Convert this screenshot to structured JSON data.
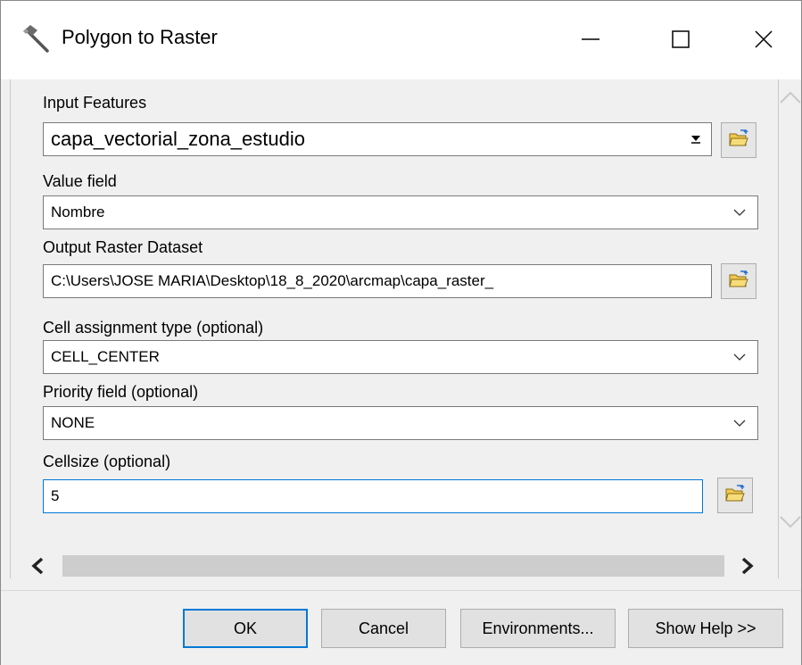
{
  "window": {
    "title": "Polygon to Raster",
    "icon": "hammer-icon",
    "controls": [
      "minimize-icon",
      "maximize-icon",
      "close-icon"
    ]
  },
  "fields": {
    "input_features": {
      "label": "Input Features",
      "value": "capa_vectorial_zona_estudio"
    },
    "value_field": {
      "label": "Value field",
      "value": "Nombre"
    },
    "output_raster": {
      "label": "Output Raster Dataset",
      "value": "C:\\Users\\JOSE MARIA\\Desktop\\18_8_2020\\arcmap\\capa_raster_"
    },
    "cell_assignment": {
      "label": "Cell assignment type (optional)",
      "value": "CELL_CENTER"
    },
    "priority_field": {
      "label": "Priority field (optional)",
      "value": "NONE"
    },
    "cellsize": {
      "label": "Cellsize (optional)",
      "value": "5"
    }
  },
  "buttons": {
    "ok": "OK",
    "cancel": "Cancel",
    "environments": "Environments...",
    "show_help": "Show Help >>"
  },
  "colors": {
    "focus_border": "#0078d7",
    "panel_bg": "#f0f0f0",
    "folder_yellow": "#f2c94c"
  }
}
